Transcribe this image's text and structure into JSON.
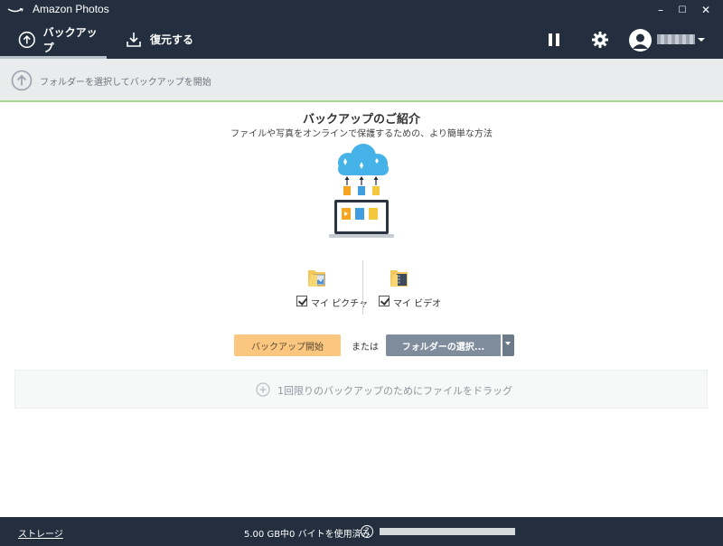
{
  "window": {
    "title": "Amazon Photos",
    "minimize_label": "–",
    "maximize_label": "☐",
    "close_label": "✕"
  },
  "toolbar": {
    "tabs": [
      {
        "label": "バックアップ",
        "icon": "upload-circle-icon",
        "active": true
      },
      {
        "label": "復元する",
        "icon": "download-icon",
        "active": false
      }
    ],
    "pause_icon": "pause-icon",
    "settings_icon": "gear-icon"
  },
  "select_bar": {
    "label": "フォルダーを選択してバックアップを開始"
  },
  "intro": {
    "title": "バックアップのご紹介",
    "subtitle": "ファイルや写真をオンラインで保護するための、より簡単な方法"
  },
  "folders": [
    {
      "label": "マイ ピクチャ",
      "checked": true,
      "icon": "pictures-folder-icon"
    },
    {
      "label": "マイ ビデオ",
      "checked": true,
      "icon": "video-folder-icon"
    }
  ],
  "actions": {
    "start_backup": "バックアップ開始",
    "or": "または",
    "select_folder": "フォルダーの選択..."
  },
  "dropzone": {
    "text": "1回限りのバックアップのためにファイルをドラッグ"
  },
  "status": {
    "storage_link": "ストレージ",
    "usage_text": "5.00 GB中0 バイトを使用済み",
    "help_label": "?",
    "usage_fraction": 0
  },
  "colors": {
    "chrome": "#232f3e",
    "start_button": "#fbc680",
    "folder_button": "#7e8c9c",
    "progress_fill": "#2a9fd6"
  }
}
